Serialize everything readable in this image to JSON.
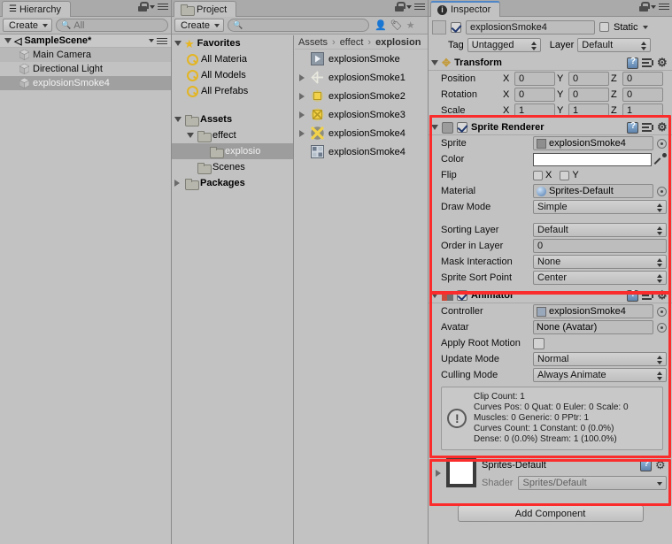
{
  "hierarchy": {
    "tab_label": "Hierarchy",
    "tab_icon": "hierarchy-icon",
    "create_label": "Create",
    "search_placeholder": "All",
    "scene_name": "SampleScene*",
    "items": [
      {
        "label": "Main Camera",
        "selected": false
      },
      {
        "label": "Directional Light",
        "selected": false
      },
      {
        "label": "explosionSmoke4",
        "selected": true
      }
    ]
  },
  "project": {
    "tab_label": "Project",
    "tab_icon": "folder-icon",
    "create_label": "Create",
    "search_placeholder": "",
    "toolbar_icons": [
      "person-filter-icon",
      "label-filter-icon",
      "star-filter-icon"
    ],
    "favorites": {
      "label": "Favorites",
      "items": [
        "All Materia",
        "All Models",
        "All Prefabs"
      ]
    },
    "tree": [
      {
        "label": "Assets",
        "depth": 0,
        "expanded": true,
        "bold": true,
        "selected": false
      },
      {
        "label": "effect",
        "depth": 1,
        "expanded": true,
        "bold": false,
        "selected": false
      },
      {
        "label": "explosio",
        "depth": 2,
        "expanded": false,
        "bold": false,
        "selected": true
      },
      {
        "label": "Scenes",
        "depth": 1,
        "expanded": false,
        "bold": false,
        "selected": false
      },
      {
        "label": "Packages",
        "depth": 0,
        "expanded": false,
        "bold": true,
        "selected": false
      }
    ],
    "breadcrumb": [
      "Assets",
      "effect",
      "explosion"
    ],
    "assets": [
      {
        "label": "explosionSmoke",
        "icon": "animation-clip-icon",
        "expandable": false
      },
      {
        "label": "explosionSmoke1",
        "icon": "sprite-icon-faint",
        "expandable": true
      },
      {
        "label": "explosionSmoke2",
        "icon": "sprite-icon-small",
        "expandable": true
      },
      {
        "label": "explosionSmoke3",
        "icon": "sprite-icon-medium",
        "expandable": true
      },
      {
        "label": "explosionSmoke4",
        "icon": "sprite-icon-large",
        "expandable": true
      },
      {
        "label": "explosionSmoke4",
        "icon": "animator-controller-icon",
        "expandable": false
      }
    ]
  },
  "inspector": {
    "tab_label": "Inspector",
    "tab_icon": "info-icon",
    "game_object": {
      "name": "explosionSmoke4",
      "enabled": true,
      "static_label": "Static",
      "static_checked": false,
      "tag_label": "Tag",
      "tag_value": "Untagged",
      "layer_label": "Layer",
      "layer_value": "Default"
    },
    "transform": {
      "title": "Transform",
      "rows": [
        {
          "label": "Position",
          "x": "0",
          "y": "0",
          "z": "0"
        },
        {
          "label": "Rotation",
          "x": "0",
          "y": "0",
          "z": "0"
        },
        {
          "label": "Scale",
          "x": "1",
          "y": "1",
          "z": "1"
        }
      ],
      "axis_labels": [
        "X",
        "Y",
        "Z"
      ]
    },
    "sprite_renderer": {
      "title": "Sprite Renderer",
      "enabled": true,
      "highlighted": true,
      "sprite_label": "Sprite",
      "sprite_value": "explosionSmoke4",
      "color_label": "Color",
      "color_value": "#FFFFFF",
      "flip_label": "Flip",
      "flip_x_label": "X",
      "flip_y_label": "Y",
      "flip_x": false,
      "flip_y": false,
      "material_label": "Material",
      "material_value": "Sprites-Default",
      "draw_mode_label": "Draw Mode",
      "draw_mode_value": "Simple",
      "sorting_layer_label": "Sorting Layer",
      "sorting_layer_value": "Default",
      "order_in_layer_label": "Order in Layer",
      "order_in_layer_value": "0",
      "mask_interaction_label": "Mask Interaction",
      "mask_interaction_value": "None",
      "sprite_sort_point_label": "Sprite Sort Point",
      "sprite_sort_point_value": "Center"
    },
    "animator": {
      "title": "Animator",
      "enabled": true,
      "highlighted": true,
      "controller_label": "Controller",
      "controller_value": "explosionSmoke4",
      "avatar_label": "Avatar",
      "avatar_value": "None (Avatar)",
      "apply_root_motion_label": "Apply Root Motion",
      "apply_root_motion": false,
      "update_mode_label": "Update Mode",
      "update_mode_value": "Normal",
      "culling_mode_label": "Culling Mode",
      "culling_mode_value": "Always Animate",
      "info_lines": [
        "Clip Count: 1",
        "Curves Pos: 0 Quat: 0 Euler: 0 Scale: 0",
        "Muscles: 0 Generic: 0 PPtr: 1",
        "Curves Count: 1 Constant: 0 (0.0%)",
        "Dense: 0 (0.0%) Stream: 1 (100.0%)"
      ]
    },
    "material": {
      "name": "Sprites-Default",
      "shader_label": "Shader",
      "shader_value": "Sprites/Default",
      "highlighted": true
    },
    "add_component_label": "Add Component"
  },
  "colors": {
    "highlight_red": "#FB2C2C",
    "panel_bg": "#C2C2C2",
    "selection": "#A0A0A0"
  }
}
